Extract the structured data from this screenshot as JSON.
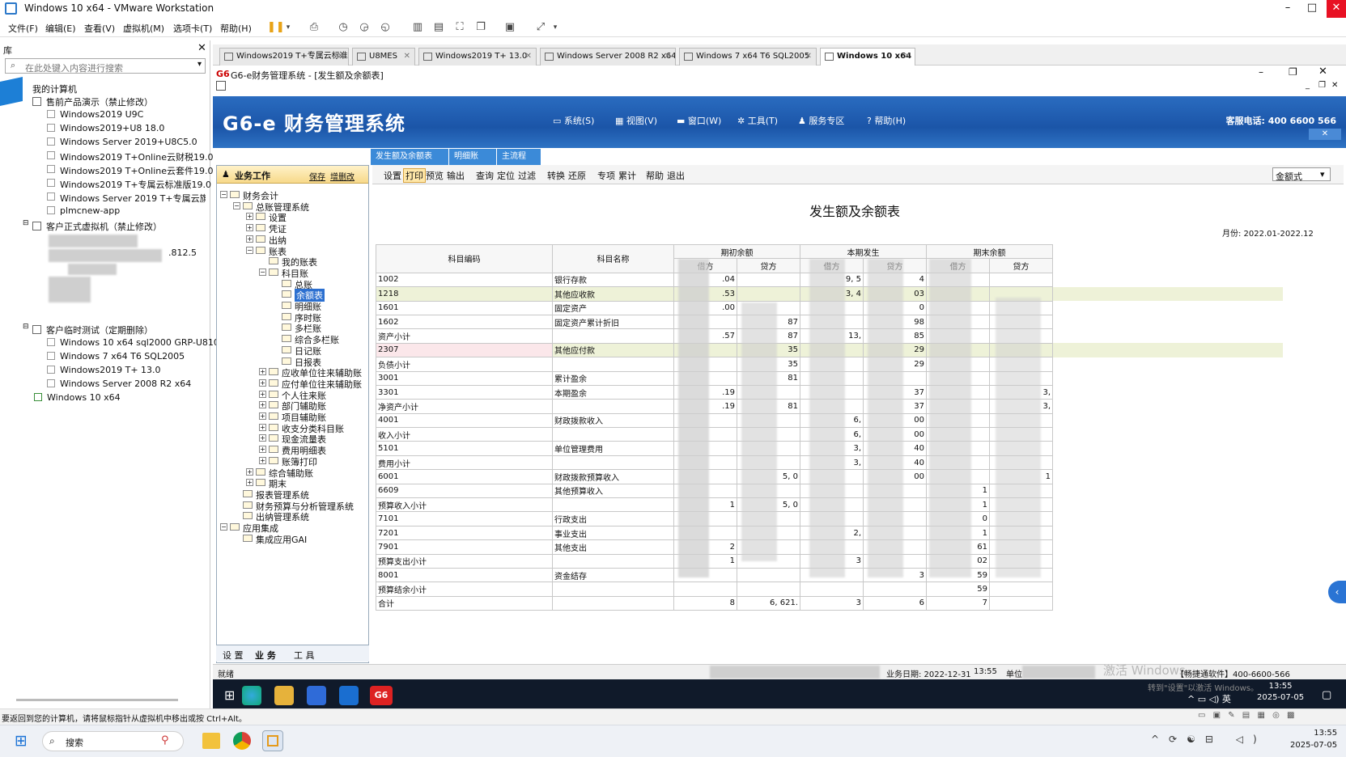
{
  "window": {
    "title": "Windows 10 x64 - VMware Workstation"
  },
  "menu": [
    "文件(F)",
    "编辑(E)",
    "查看(V)",
    "虚拟机(M)",
    "选项卡(T)",
    "帮助(H)"
  ],
  "library": {
    "header": "库",
    "search_placeholder": "在此处键入内容进行搜索",
    "root": "我的计算机",
    "groups": [
      {
        "label": "售前产品演示（禁止修改）",
        "items": [
          "Windows2019 U9C",
          "Windows2019+U8 18.0",
          "Windows Server 2019+U8C5.0",
          "Windows2019 T+Online云财税19.0",
          "Windows2019 T+Online云套件19.0",
          "Windows2019 T+专属云标准版19.0",
          "Windows Server 2019 T+专属云旗舰",
          "plmcnew-app"
        ]
      },
      {
        "label": "客户正式虚拟机（禁止修改）",
        "items": [
          ".812.5"
        ]
      },
      {
        "label": "客户临时测试（定期删除）",
        "items": [
          "Windows 10 x64 sql2000 GRP-U810",
          "Windows 7 x64 T6 SQL2005",
          "Windows2019 T+ 13.0",
          "Windows Server 2008 R2 x64"
        ]
      }
    ],
    "current": "Windows 10 x64"
  },
  "vm_tabs": [
    "Windows2019 T+专属云标准...",
    "U8MES",
    "Windows2019 T+ 13.0",
    "Windows Server 2008 R2 x64",
    "Windows 7 x64 T6 SQL2005",
    "Windows 10 x64"
  ],
  "app": {
    "window_title": "G6-e财务管理系统 - [发生额及余额表]",
    "logo": "G6-e 财务管理系统",
    "nav": [
      "系统(S)",
      "视图(V)",
      "窗口(W)",
      "工具(T)",
      "服务专区",
      "帮助(H)"
    ],
    "phone": "客服电话: 400 6600 566",
    "doc_tabs": [
      "发生额及余额表",
      "明细账",
      "主流程"
    ],
    "side": {
      "title": "业务工作",
      "save": "保存",
      "add": "增删改",
      "tree": [
        "财务会计",
        "总账管理系统",
        "设置",
        "凭证",
        "出纳",
        "账表",
        "我的账表",
        "科目账",
        "总账",
        "余额表",
        "明细账",
        "序时账",
        "多栏账",
        "综合多栏账",
        "日记账",
        "日报表",
        "应收单位往来辅助账",
        "应付单位往来辅助账",
        "个人往来账",
        "部门辅助账",
        "项目辅助账",
        "收支分类科目账",
        "现金流量表",
        "费用明细表",
        "账簿打印",
        "综合辅助账",
        "期末",
        "报表管理系统",
        "财务预算与分析管理系统",
        "出纳管理系统",
        "应用集成",
        "集成应用GAI"
      ],
      "tabs": [
        "设 置",
        "业 务",
        "工 具"
      ]
    },
    "toolbar": [
      "设置",
      "打印",
      "预览",
      "输出",
      "查询",
      "定位",
      "过滤",
      "转换",
      "还原",
      "专项",
      "累计",
      "帮助",
      "退出"
    ],
    "format_select": "金额式",
    "report": {
      "title": "发生额及余额表",
      "month": "月份: 2022.01-2022.12",
      "headers": {
        "code": "科目编码",
        "name": "科目名称",
        "open": "期初余额",
        "occur": "本期发生",
        "close": "期末余额",
        "debit": "借方",
        "credit": "贷方"
      },
      "rows": [
        {
          "code": "1002",
          "name": "银行存款",
          "c1": ".04",
          "c2": "",
          "c3": "9, 5",
          "c4": "4",
          "c5": "",
          "c6": ""
        },
        {
          "code": "1218",
          "name": "其他应收款",
          "c1": ".53",
          "c2": "",
          "c3": "3, 4",
          "c4": "03",
          "c5": "",
          "c6": ""
        },
        {
          "code": "1601",
          "name": "固定资产",
          "c1": ".00",
          "c2": "",
          "c3": "",
          "c4": "0",
          "c5": "",
          "c6": ""
        },
        {
          "code": "1602",
          "name": "固定资产累计折旧",
          "c1": "",
          "c2": "87",
          "c3": "",
          "c4": "98",
          "c5": "",
          "c6": ""
        },
        {
          "code": "资产小计",
          "name": "",
          "c1": ".57",
          "c2": "87",
          "c3": "13,",
          "c4": "85",
          "c5": "",
          "c6": ""
        },
        {
          "code": "2307",
          "name": "其他应付款",
          "c1": "",
          "c2": "35",
          "c3": "",
          "c4": "29",
          "c5": "",
          "c6": ""
        },
        {
          "code": "负债小计",
          "name": "",
          "c1": "",
          "c2": "35",
          "c3": "",
          "c4": "29",
          "c5": "",
          "c6": ""
        },
        {
          "code": "3001",
          "name": "累计盈余",
          "c1": "",
          "c2": "81",
          "c3": "",
          "c4": "",
          "c5": "",
          "c6": ""
        },
        {
          "code": "3301",
          "name": "本期盈余",
          "c1": ".19",
          "c2": "",
          "c3": "",
          "c4": "37",
          "c5": "",
          "c6": "3,"
        },
        {
          "code": "净资产小计",
          "name": "",
          "c1": ".19",
          "c2": "81",
          "c3": "",
          "c4": "37",
          "c5": "",
          "c6": "3,"
        },
        {
          "code": "4001",
          "name": "财政拨款收入",
          "c1": "",
          "c2": "",
          "c3": "6,",
          "c4": "00",
          "c5": "",
          "c6": ""
        },
        {
          "code": "收入小计",
          "name": "",
          "c1": "",
          "c2": "",
          "c3": "6,",
          "c4": "00",
          "c5": "",
          "c6": ""
        },
        {
          "code": "5101",
          "name": "单位管理费用",
          "c1": "",
          "c2": "",
          "c3": "3,",
          "c4": "40",
          "c5": "",
          "c6": ""
        },
        {
          "code": "费用小计",
          "name": "",
          "c1": "",
          "c2": "",
          "c3": "3,",
          "c4": "40",
          "c5": "",
          "c6": ""
        },
        {
          "code": "6001",
          "name": "财政拨款预算收入",
          "c1": "",
          "c2": "5, 0",
          "c3": "",
          "c4": "00",
          "c5": "",
          "c6": "1"
        },
        {
          "code": "6609",
          "name": "其他预算收入",
          "c1": "",
          "c2": "",
          "c3": "",
          "c4": "",
          "c5": "1",
          "c6": ""
        },
        {
          "code": "预算收入小计",
          "name": "",
          "c1": "1",
          "c2": "5, 0",
          "c3": "",
          "c4": "",
          "c5": "1",
          "c6": ""
        },
        {
          "code": "7101",
          "name": "行政支出",
          "c1": "",
          "c2": "",
          "c3": "",
          "c4": "",
          "c5": "0",
          "c6": ""
        },
        {
          "code": "7201",
          "name": "事业支出",
          "c1": "",
          "c2": "",
          "c3": "2,",
          "c4": "",
          "c5": "1",
          "c6": ""
        },
        {
          "code": "7901",
          "name": "其他支出",
          "c1": "2",
          "c2": "",
          "c3": "",
          "c4": "",
          "c5": "61",
          "c6": ""
        },
        {
          "code": "预算支出小计",
          "name": "",
          "c1": "1",
          "c2": "",
          "c3": "3",
          "c4": "",
          "c5": "02",
          "c6": ""
        },
        {
          "code": "8001",
          "name": "资金结存",
          "c1": "",
          "c2": "",
          "c3": "",
          "c4": "3",
          "c5": "59",
          "c6": ""
        },
        {
          "code": "预算结余小计",
          "name": "",
          "c1": "",
          "c2": "",
          "c3": "",
          "c4": "",
          "c5": "59",
          "c6": ""
        },
        {
          "code": "合计",
          "name": "",
          "c1": "8",
          "c2": "6, 621.",
          "c3": "3",
          "c4": "6",
          "c5": "7",
          "c6": ""
        }
      ]
    },
    "status": {
      "ready": "就绪",
      "date": "业务日期: 2022-12-31",
      "time": "13:55",
      "unit": "单位",
      "company": "【畅捷通软件】400-6600-566",
      "watermark": "激活 Windows",
      "watermark_sub": "转到\"设置\"以激活 Windows。"
    }
  },
  "guest_clock": {
    "time": "13:55",
    "date": "2025-07-05"
  },
  "host_hint": "要返回到您的计算机，请将鼠标指针从虚拟机中移出或按 Ctrl+Alt。",
  "host_taskbar": {
    "search": "搜索",
    "time": "13:55",
    "date": "2025-07-05"
  },
  "colors": {
    "header_blue": "#1b55a8",
    "tab_blue": "#3b8ad8",
    "highlight_row": "#eef2d8",
    "guest_taskbar": "#101a2a"
  }
}
